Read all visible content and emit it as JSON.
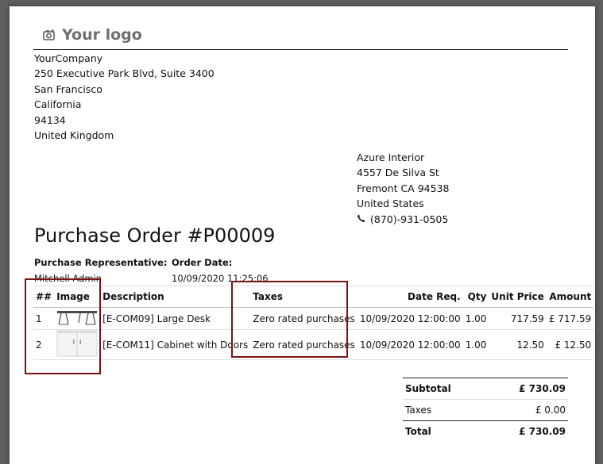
{
  "logo": {
    "text": "Your logo",
    "icon": "camera-plus-icon"
  },
  "company": {
    "lines": [
      "YourCompany",
      "250 Executive Park Blvd, Suite 3400",
      "San Francisco",
      "California",
      "94134",
      "United Kingdom"
    ]
  },
  "vendor": {
    "lines": [
      "Azure Interior",
      "4557 De Silva St",
      "Fremont CA 94538",
      "United States"
    ],
    "phone": "(870)-931-0505",
    "phone_icon": "phone-icon"
  },
  "document": {
    "title": "Purchase Order #P00009"
  },
  "info": {
    "rep_label": "Purchase Representative:",
    "rep_value": "Mitchell Admin",
    "date_label": "Order Date:",
    "date_value": "10/09/2020 11:25:06"
  },
  "table": {
    "headers": {
      "num": "##",
      "image": "Image",
      "description": "Description",
      "taxes": "Taxes",
      "date_req": "Date Req.",
      "qty": "Qty",
      "unit_price": "Unit Price",
      "amount": "Amount"
    },
    "rows": [
      {
        "num": "1",
        "image": "desk-thumbnail",
        "description": "[E-COM09] Large Desk",
        "taxes": "Zero rated purchases",
        "date_req": "10/09/2020 12:00:00",
        "qty": "1.00",
        "unit_price": "717.59",
        "amount": "£ 717.59"
      },
      {
        "num": "2",
        "image": "cabinet-thumbnail",
        "description": "[E-COM11] Cabinet with Doors",
        "taxes": "Zero rated purchases",
        "date_req": "10/09/2020 12:00:00",
        "qty": "1.00",
        "unit_price": "12.50",
        "amount": "£ 12.50"
      }
    ]
  },
  "totals": {
    "subtotal_label": "Subtotal",
    "subtotal_value": "£ 730.09",
    "taxes_label": "Taxes",
    "taxes_value": "£ 0.00",
    "total_label": "Total",
    "total_value": "£ 730.09"
  },
  "colors": {
    "highlight": "#7a1414",
    "background": "#5f5f5f",
    "paper": "#ffffff"
  }
}
